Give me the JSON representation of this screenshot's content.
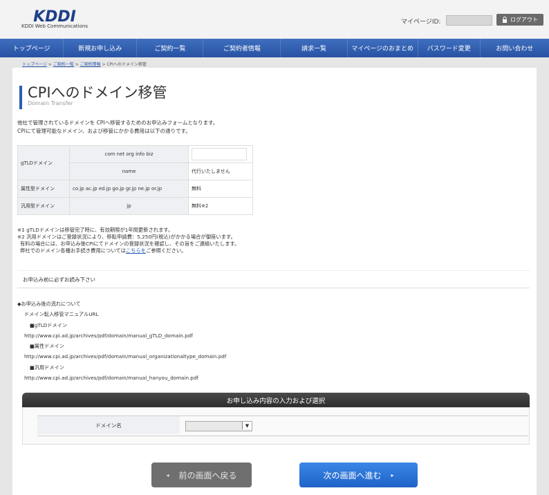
{
  "header": {
    "logo_text": "KDDI",
    "logo_sub": "KDDI Web Communications",
    "mypage_label": "マイページID:",
    "logout_label": "ログアウト"
  },
  "nav": {
    "items": [
      "トップページ",
      "新規お申し込み",
      "ご契約一覧",
      "ご契約者情報",
      "請求一覧",
      "マイページのおまとめ",
      "パスワード変更",
      "お問い合わせ"
    ]
  },
  "breadcrumb": {
    "links": [
      "トップページ",
      "ご契約一覧",
      "ご契約情報"
    ],
    "separator": " > ",
    "current": "CPIへのドメイン移管"
  },
  "page": {
    "title": "CPIへのドメイン移管",
    "subtitle": "Domain Transfer"
  },
  "intro": {
    "line1": "他社で管理されているドメインを CPIへ移管するためのお申込みフォームとなります。",
    "line2": "CPIにて管理可能なドメイン、および移管にかかる費用は以下の通りです。"
  },
  "fee_table": {
    "gtld_label": "gTLDドメイン",
    "gtld_types_1": "com  net  org  info  biz",
    "gtld_types_2": "name",
    "gtld_fee_2": "代行いたしません",
    "attr_label": "属性型ドメイン",
    "attr_types": "co.jp  ac.jp  ed.jp  go.jp  gr.jp  ne.jp  or.jp",
    "attr_fee": "無料",
    "general_label": "汎用型ドメイン",
    "general_types": "jp",
    "general_fee": "無料※2"
  },
  "notes": {
    "n1": "※1 gTLDドメインは移管完了時に、有効期限が1年間更新されます。",
    "n2": "※2 汎用ドメインはご登録状況により、移転申請費：5,250円(税込)がかかる場合が御座います。",
    "n3": "有料の場合には、お申込み後CPIにてドメインの登録状況を確認し、その旨をご連絡いたします。",
    "n4_before": "弊社でのドメイン各種お手続き費用については",
    "n4_link": "こちらを",
    "n4_after": "ご参照ください。"
  },
  "read_bar": {
    "label": "お申込み前に必ずお読み下さい"
  },
  "flow": {
    "heading": "◆お申込み後の流れについて",
    "manual_label": "ドメイン転入移管マニュアルURL",
    "gtld_heading": "■gTLDドメイン",
    "gtld_url": "http://www.cpi.ad.jp/archives/pdf/domain/manual_gTLD_domain.pdf",
    "attr_heading": "■属性ドメイン",
    "attr_url": "http://www.cpi.ad.jp/archives/pdf/domain/manual_organizationaltype_domain.pdf",
    "general_heading": "■汎用ドメイン",
    "general_url": "http://www.cpi.ad.jp/archives/pdf/domain/manual_hanyou_domain.pdf"
  },
  "form": {
    "header": "お申し込み内容の入力および選択",
    "domain_label": "ドメイン名"
  },
  "buttons": {
    "back": "前の画面へ戻る",
    "next": "次の画面へ進む"
  },
  "colors": {
    "nav_blue": "#2f5fb3",
    "accent_blue": "#1f63c8",
    "form_header": "#333333"
  }
}
